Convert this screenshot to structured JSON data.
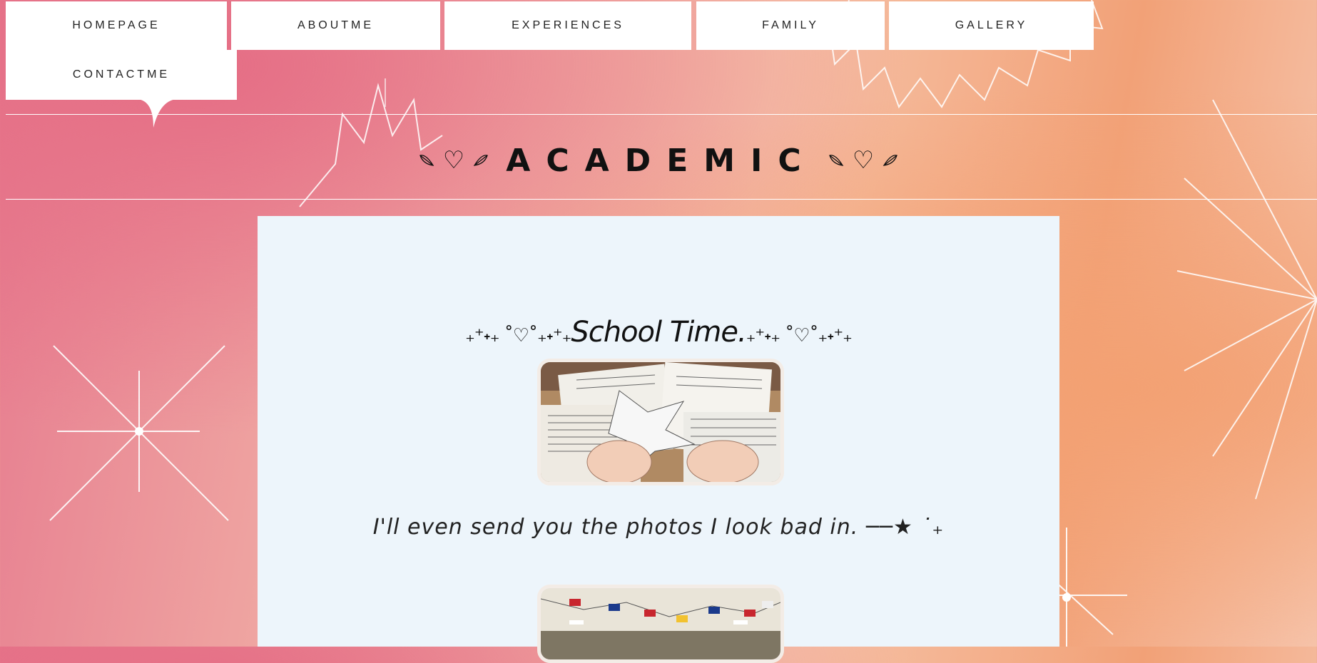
{
  "nav": {
    "items": [
      {
        "label": "HOMEPAGE"
      },
      {
        "label": "ABOUTME"
      },
      {
        "label": "EXPERIENCES"
      },
      {
        "label": "FAMILY"
      },
      {
        "label": "GALLERY"
      },
      {
        "label": "CONTACTME"
      }
    ]
  },
  "header": {
    "title": "ACADEMIC",
    "heart_glyph": "♡"
  },
  "section": {
    "sparkle_left": "₊⁺˖₊ ˚♡˚₊˖⁺₊",
    "title": "School Time.",
    "sparkle_right": "₊⁺˖₊ ˚♡˚₊˖⁺₊",
    "caption": "I'll even send you the photos I look bad in. ──★ ˙₊"
  },
  "colors": {
    "background_pink": "#e56d85",
    "background_peach": "#f3a173",
    "panel": "#edf5fb",
    "nav_bg": "#ffffff",
    "text": "#111111"
  },
  "icons": [
    "heart-icon",
    "leaf-icon",
    "sparkle-icon"
  ]
}
